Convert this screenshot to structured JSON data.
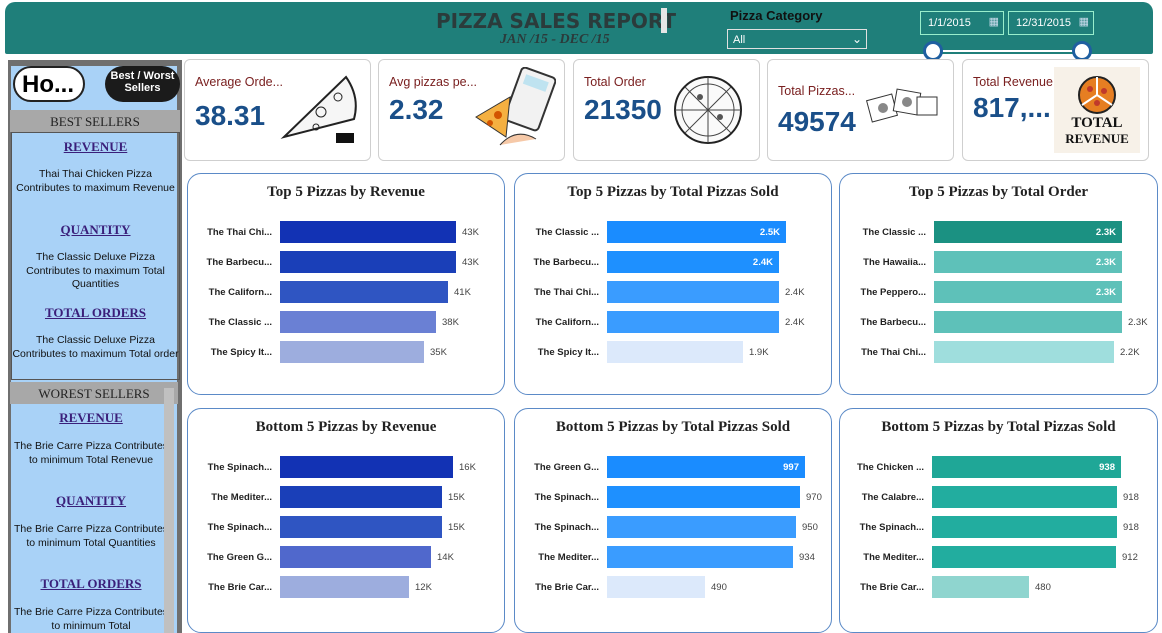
{
  "header": {
    "title": "PIZZA SALES REPORT",
    "subtitle": "JAN /15 - DEC /15",
    "category_label": "Pizza Category",
    "category_value": "All",
    "date_start": "1/1/2015",
    "date_end": "12/31/2015"
  },
  "sidebar": {
    "home_label": "Ho...",
    "toggle_label": "Best / Worst Sellers",
    "best_header": "BEST SELLERS",
    "worst_header": "WOREST SELLERS",
    "best": [
      {
        "h": "REVENUE",
        "t": "Thai Thai Chicken Pizza Contributes to maximum Revenue"
      },
      {
        "h": "QUANTITY",
        "t": "The Classic Deluxe Pizza Contributes to maximum Total Quantities"
      },
      {
        "h": "TOTAL ORDERS",
        "t": "The Classic Deluxe Pizza Contributes to maximum Total order"
      }
    ],
    "worst": [
      {
        "h": "REVENUE",
        "t": "The Brie Carre Pizza Contributes  to minimum Total Renevue"
      },
      {
        "h": "QUANTITY",
        "t": "The Brie Carre Pizza Contributes to minimum Total Quantities"
      },
      {
        "h": "TOTAL ORDERS",
        "t": "The Brie Carre Pizza Contributes to minimum Total"
      }
    ]
  },
  "kpis": [
    {
      "label": "Average Orde...",
      "value": "38.31",
      "icon": "pizza-slice-sketch-icon"
    },
    {
      "label": "Avg pizzas pe...",
      "value": "2.32",
      "icon": "calculator-pizza-icon"
    },
    {
      "label": "Total Order",
      "value": "21350",
      "icon": "whole-pizza-sketch-icon"
    },
    {
      "label": "Total Pizzas...",
      "value": "49574",
      "icon": "pizza-boxes-sketch-icon"
    },
    {
      "label": "Total Revenue",
      "value": "817,...",
      "icon": "total-revenue-badge",
      "icon_text": "TOTAL REVENUE"
    }
  ],
  "chart_data": [
    {
      "type": "bar",
      "title": "Top 5 Pizzas by Revenue",
      "categories": [
        "The Thai Chi...",
        "The Barbecu...",
        "The Californ...",
        "The Classic ...",
        "The Spicy It..."
      ],
      "values": [
        43,
        43,
        41,
        38,
        35
      ],
      "value_labels": [
        "43K",
        "43K",
        "41K",
        "38K",
        "35K"
      ],
      "max": 50,
      "colors": [
        "#1232b4",
        "#1a3fb8",
        "#2f55c2",
        "#6a80d4",
        "#9dadde"
      ],
      "inside": [
        false,
        false,
        false,
        false,
        false
      ]
    },
    {
      "type": "bar",
      "title": "Top 5 Pizzas by Total Pizzas Sold",
      "categories": [
        "The Classic ...",
        "The Barbecu...",
        "The Thai Chi...",
        "The Californ...",
        "The Spicy It..."
      ],
      "values": [
        2.5,
        2.4,
        2.4,
        2.4,
        1.9
      ],
      "value_labels": [
        "2.5K",
        "2.4K",
        "2.4K",
        "2.4K",
        "1.9K"
      ],
      "max": 3.0,
      "colors": [
        "#1a8cff",
        "#1e90ff",
        "#3a9cff",
        "#3a9cff",
        "#dce9fb"
      ],
      "inside": [
        true,
        true,
        false,
        false,
        false
      ]
    },
    {
      "type": "bar",
      "title": "Top 5 Pizzas by Total Order",
      "categories": [
        "The Classic ...",
        "The Hawaiia...",
        "The Peppero...",
        "The Barbecu...",
        "The Thai Chi..."
      ],
      "values": [
        2.3,
        2.3,
        2.3,
        2.3,
        2.2
      ],
      "value_labels": [
        "2.3K",
        "2.3K",
        "2.3K",
        "2.3K",
        "2.2K"
      ],
      "max": 2.6,
      "colors": [
        "#1b9182",
        "#5ec1b9",
        "#5ec1b9",
        "#5ec1b9",
        "#9fdedd"
      ],
      "inside": [
        true,
        true,
        true,
        false,
        false
      ]
    },
    {
      "type": "bar",
      "title": "Bottom 5 Pizzas by Revenue",
      "categories": [
        "The Spinach...",
        "The Mediter...",
        "The Spinach...",
        "The Green G...",
        "The Brie Car..."
      ],
      "values": [
        16,
        15,
        15,
        14,
        12
      ],
      "value_labels": [
        "16K",
        "15K",
        "15K",
        "14K",
        "12K"
      ],
      "max": 19,
      "colors": [
        "#1232b4",
        "#1a3fb8",
        "#2f55c2",
        "#5068cc",
        "#9dadde"
      ],
      "inside": [
        false,
        false,
        false,
        false,
        false
      ]
    },
    {
      "type": "bar",
      "title": "Bottom 5 Pizzas by Total Pizzas Sold",
      "categories": [
        "The Green G...",
        "The Spinach...",
        "The Spinach...",
        "The Mediter...",
        "The Brie Car..."
      ],
      "values": [
        997,
        970,
        950,
        934,
        490
      ],
      "value_labels": [
        "997",
        "970",
        "950",
        "934",
        "490"
      ],
      "max": 1080,
      "colors": [
        "#1a8cff",
        "#1e90ff",
        "#3a9cff",
        "#3a9cff",
        "#dce9fb"
      ],
      "inside": [
        true,
        false,
        false,
        false,
        false
      ]
    },
    {
      "type": "bar",
      "title": "Bottom 5 Pizzas by Total Pizzas Sold",
      "categories": [
        "The Chicken ...",
        "The Calabre...",
        "The Spinach...",
        "The Mediter...",
        "The Brie Car..."
      ],
      "values": [
        938,
        918,
        918,
        912,
        480
      ],
      "value_labels": [
        "938",
        "918",
        "918",
        "912",
        "480"
      ],
      "max": 1040,
      "colors": [
        "#1fa797",
        "#22ad9f",
        "#22ad9f",
        "#22ad9f",
        "#8fd5cf"
      ],
      "inside": [
        true,
        false,
        false,
        false,
        false
      ]
    }
  ]
}
